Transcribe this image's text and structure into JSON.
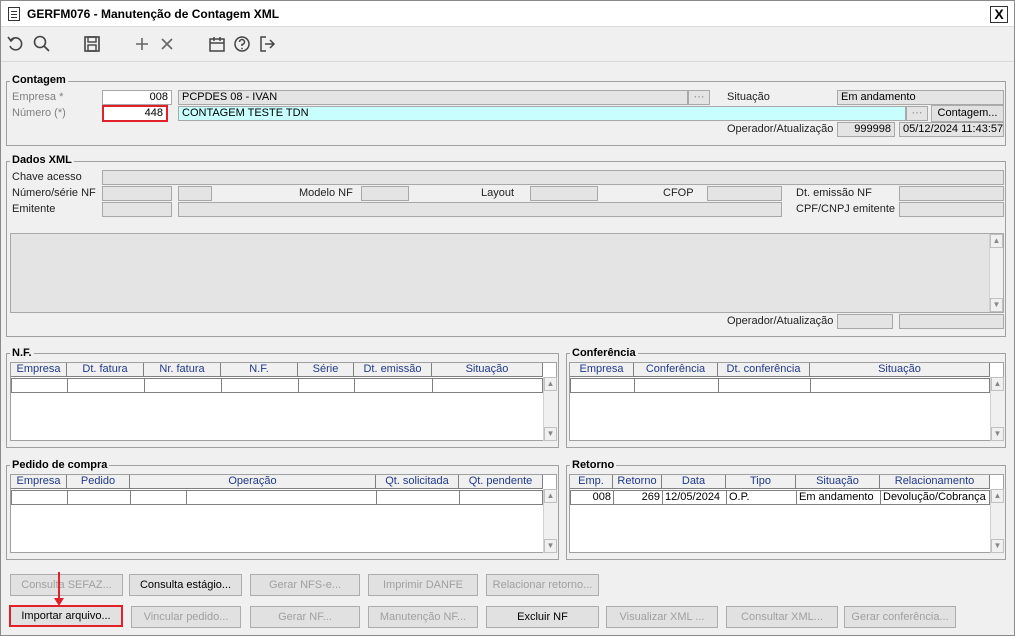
{
  "window": {
    "title": "GERFM076 - Manutenção de Contagem XML",
    "close_label": "X"
  },
  "toolbar": {
    "icons": [
      "undo-icon",
      "search-icon",
      "save-icon",
      "plus-icon",
      "close-icon",
      "calendar-icon",
      "help-icon",
      "exit-icon"
    ]
  },
  "contagem": {
    "group_label": "Contagem",
    "empresa_label": "Empresa *",
    "empresa_value": "008",
    "empresa_name": "PCPDES 08 - IVAN",
    "numero_label": "Número (*)",
    "numero_value": "448",
    "descricao": "CONTAGEM TESTE TDN",
    "situacao_label": "Situação",
    "situacao_value": "Em andamento",
    "contagem_button": "Contagem...",
    "operador_label": "Operador/Atualização",
    "operador_value": "999998",
    "atualizacao_value": "05/12/2024 11:43:57"
  },
  "dados_xml": {
    "group_label": "Dados XML",
    "chave_label": "Chave acesso",
    "numero_serie_label": "Número/série NF",
    "modelo_label": "Modelo NF",
    "layout_label": "Layout",
    "cfop_label": "CFOP",
    "dt_emissao_label": "Dt. emissão NF",
    "emitente_label": "Emitente",
    "cpf_label": "CPF/CNPJ emitente",
    "operador_label": "Operador/Atualização"
  },
  "nf": {
    "group_label": "N.F.",
    "columns": [
      "Empresa",
      "Dt. fatura",
      "Nr. fatura",
      "N.F.",
      "Série",
      "Dt. emissão",
      "Situação"
    ]
  },
  "conferencia": {
    "group_label": "Conferência",
    "columns": [
      "Empresa",
      "Conferência",
      "Dt. conferência",
      "Situação"
    ]
  },
  "pedido": {
    "group_label": "Pedido de compra",
    "columns": [
      "Empresa",
      "Pedido",
      "Operação",
      "Qt. solicitada",
      "Qt. pendente"
    ]
  },
  "retorno": {
    "group_label": "Retorno",
    "columns": [
      "Emp.",
      "Retorno",
      "Data",
      "Tipo",
      "Situação",
      "Relacionamento"
    ],
    "rows": [
      [
        "008",
        "269",
        "12/05/2024",
        "O.P.",
        "Em andamento",
        "Devolução/Cobrança"
      ]
    ]
  },
  "buttons_row1": [
    "Consulta SEFAZ...",
    "Consulta estágio...",
    "Gerar NFS-e...",
    "Imprimir DANFE",
    "Relacionar retorno..."
  ],
  "buttons_row2": [
    "Importar arquivo...",
    "Vincular pedido...",
    "Gerar NF...",
    "Manutenção NF...",
    "Excluir NF",
    "Visualizar XML ...",
    "Consultar XML...",
    "Gerar conferência..."
  ]
}
